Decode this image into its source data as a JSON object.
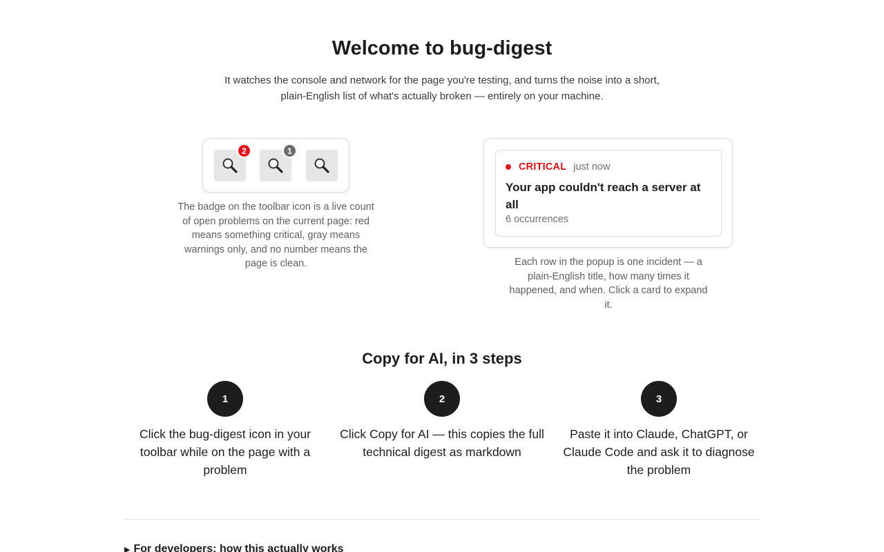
{
  "header": {
    "title": "Welcome to bug-digest",
    "subtitle": "It watches the console and network for the page you're testing, and turns the noise into a short, plain-English list of what's actually broken — entirely on your machine."
  },
  "toolbar_demo": {
    "icons": [
      {
        "icon": "magnifier-icon",
        "badge": "2",
        "badge_color": "#e0141e"
      },
      {
        "icon": "magnifier-icon",
        "badge": "1",
        "badge_color": "#6b6b6b"
      },
      {
        "icon": "magnifier-icon",
        "badge": ""
      }
    ],
    "caption": "The badge on the toolbar icon is a live count of open problems on the current page: red means something critical, gray means warnings only, and no number means the page is clean."
  },
  "popup_demo": {
    "severity": "CRITICAL",
    "time": "just now",
    "title": "Your app couldn't reach a server at all",
    "occurrences": "6 occurrences",
    "caption": "Each row in the popup is one incident — a plain-English title, how many times it happened, and when. Click a card to expand it."
  },
  "steps": {
    "title": "Copy for AI, in 3 steps",
    "items": [
      {
        "number": "1",
        "text": "Click the bug-digest icon in your toolbar while on the page with a problem"
      },
      {
        "number": "2",
        "text_before": "Click ",
        "emphasis": "Copy for AI",
        "text_after": " — this copies the full technical digest as markdown"
      },
      {
        "number": "3",
        "text": "Paste it into Claude, ChatGPT, or Claude Code and ask it to diagnose the problem"
      }
    ]
  },
  "developers": {
    "summary": "For developers: how this actually works"
  },
  "colors": {
    "critical": "#e0141e",
    "warning": "#6b6b6b",
    "step_circle": "#1d1d1f"
  }
}
